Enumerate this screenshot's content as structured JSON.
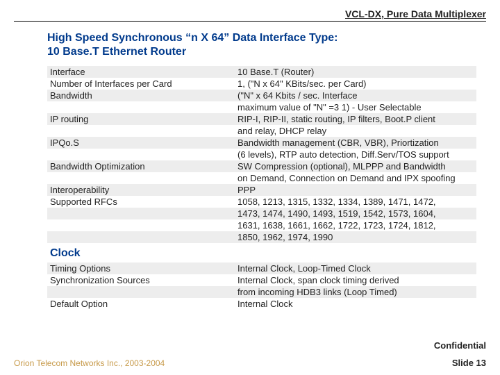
{
  "header": "VCL-DX, Pure Data Multiplexer",
  "title_line1": "High Speed Synchronous  “n X 64” Data Interface Type:",
  "title_line2": "10 Base.T Ethernet Router",
  "rows": {
    "r0k": "Interface",
    "r0v": "10 Base.T (Router)",
    "r1k": "Number of Interfaces per Card",
    "r1v": "1, (\"N x 64\" KBits/sec. per Card)",
    "r2k": "Bandwidth",
    "r2v": "(\"N\" x 64 Kbits / sec. Interface",
    "r3v": "maximum value of \"N\" =3 1) - User Selectable",
    "r4k": "IP routing",
    "r4v": "RIP-I, RIP-II, static routing, IP filters, Boot.P client",
    "r5v": "and relay, DHCP relay",
    "r6k": "IPQo.S",
    "r6v": "Bandwidth management (CBR, VBR), Priortization",
    "r7v": "(6 levels), RTP auto detection, Diff.Serv/TOS support",
    "r8k": "Bandwidth Optimization",
    "r8v": "SW Compression (optional), MLPPP and Bandwidth",
    "r9v": "on Demand, Connection on Demand and IPX spoofing",
    "r10k": "Interoperability",
    "r10v": "PPP",
    "r11k": "Supported RFCs",
    "r11v": "1058, 1213, 1315, 1332, 1334, 1389, 1471, 1472,",
    "r12v": "1473, 1474, 1490, 1493, 1519, 1542, 1573, 1604,",
    "r13v": "1631, 1638, 1661, 1662, 1722, 1723, 1724, 1812,",
    "r14v": "1850, 1962, 1974, 1990"
  },
  "section2": "Clock",
  "clock": {
    "c0k": "Timing Options",
    "c0v": "Internal Clock, Loop-Timed Clock",
    "c1k": "Synchronization Sources",
    "c1v": "Internal Clock, span clock timing derived",
    "c2v": "from incoming HDB3 links (Loop Timed)",
    "c3k": "Default Option",
    "c3v": "Internal Clock"
  },
  "confidential": "Confidential",
  "company": "Orion Telecom Networks Inc., 2003-2004",
  "slide": "Slide 13"
}
